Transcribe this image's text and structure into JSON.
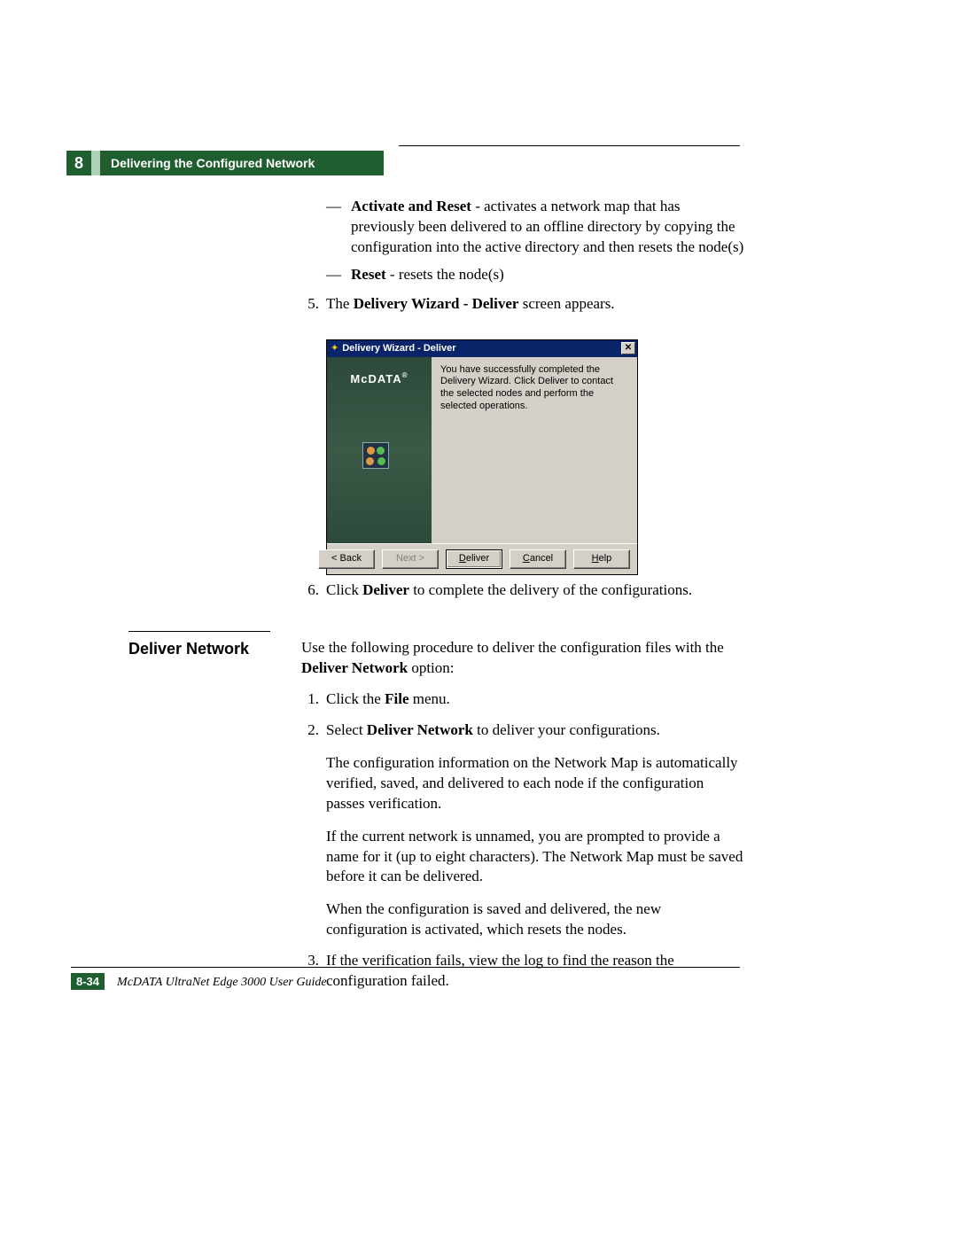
{
  "chapter_number": "8",
  "header_title": "Delivering the Configured Network",
  "bullets": {
    "activate_reset": {
      "label": "Activate and Reset",
      "text": " - activates a network map that has previously been delivered to an offline directory by copying the configuration into the active directory and then resets the node(s)"
    },
    "reset": {
      "label": "Reset",
      "text": " - resets the node(s)"
    }
  },
  "step5": {
    "num": "5.",
    "pre": "The ",
    "bold": "Delivery Wizard - Deliver",
    "post": " screen appears."
  },
  "dialog": {
    "title": "Delivery Wizard - Deliver",
    "brand": "McDATA",
    "message": "You have successfully completed the Delivery Wizard. Click Deliver to contact the selected nodes and perform the selected operations.",
    "buttons": {
      "back": "< Back",
      "next": "Next >",
      "deliver_u": "D",
      "deliver_rest": "eliver",
      "cancel_u": "C",
      "cancel_rest": "ancel",
      "help_u": "H",
      "help_rest": "elp"
    }
  },
  "step6": {
    "num": "6.",
    "pre": "Click ",
    "bold": "Deliver",
    "post": " to complete the delivery of the configurations."
  },
  "section": {
    "heading": "Deliver Network",
    "intro_pre": "Use the following procedure to deliver the configuration files with the ",
    "intro_bold": "Deliver Network",
    "intro_post": " option:",
    "s1": {
      "num": "1.",
      "pre": "Click the ",
      "bold": "File",
      "post": " menu."
    },
    "s2": {
      "num": "2.",
      "pre": "Select ",
      "bold": "Deliver Network",
      "post": " to deliver your configurations."
    },
    "s2p2": "The configuration information on the Network Map is automatically verified, saved, and delivered to each node if the configuration passes verification.",
    "s2p3": "If the current network is unnamed, you are prompted to provide a name for it (up to eight characters). The Network Map must be saved before it can be delivered.",
    "s2p4": "When the configuration is saved and delivered, the new configuration is activated, which resets the nodes.",
    "s3": {
      "num": "3.",
      "text": "If the verification fails, view the log to find the reason the configuration failed."
    }
  },
  "footer": {
    "page": "8-34",
    "guide": "McDATA UltraNet Edge 3000 User Guide"
  }
}
